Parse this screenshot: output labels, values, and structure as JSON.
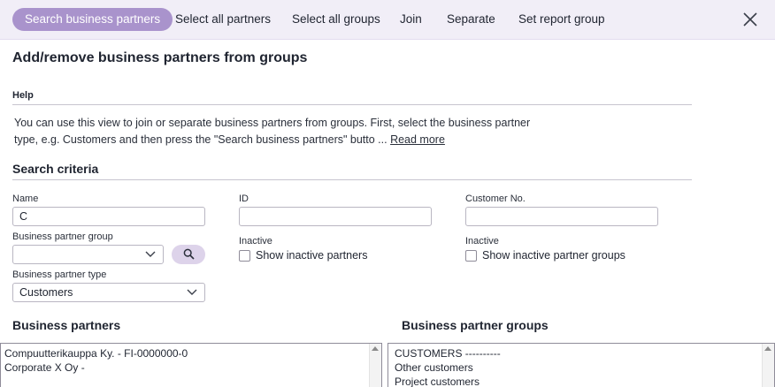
{
  "toolbar": {
    "search_partners": "Search business partners",
    "select_all_partners": "Select all partners",
    "select_all_groups": "Select all groups",
    "join": "Join",
    "separate": "Separate",
    "set_report_group": "Set report group"
  },
  "page": {
    "title": "Add/remove business partners from groups"
  },
  "help": {
    "heading": "Help",
    "line1": "You can use this view to join or separate business partners from groups. First, select the business partner",
    "line2": "type, e.g. Customers and then press the \"Search business partners\" butto ... ",
    "read_more": "Read more"
  },
  "search": {
    "heading": "Search criteria",
    "name_label": "Name",
    "name_value": "C",
    "id_label": "ID",
    "id_value": "",
    "customer_no_label": "Customer No.",
    "customer_no_value": "",
    "group_label": "Business partner group",
    "group_value": "",
    "type_label": "Business partner type",
    "type_value": "Customers",
    "inactive_label_1": "Inactive",
    "show_inactive_partners": "Show inactive partners",
    "inactive_label_2": "Inactive",
    "show_inactive_groups": "Show inactive partner groups"
  },
  "partners": {
    "heading": "Business partners",
    "items": [
      "Compuutterikauppa Ky. - FI-0000000-0",
      "Corporate X Oy -"
    ]
  },
  "groups": {
    "heading": "Business partner groups",
    "items": [
      "CUSTOMERS ----------",
      "Other customers",
      "Project customers"
    ]
  },
  "colors": {
    "accent": "#a993cc",
    "toolbar_bg": "#f1eef7",
    "search_btn_bg": "#ddd3ea"
  },
  "icons": {
    "close": "close-icon",
    "search": "search-icon",
    "dropdown": "chevron-down-icon"
  }
}
